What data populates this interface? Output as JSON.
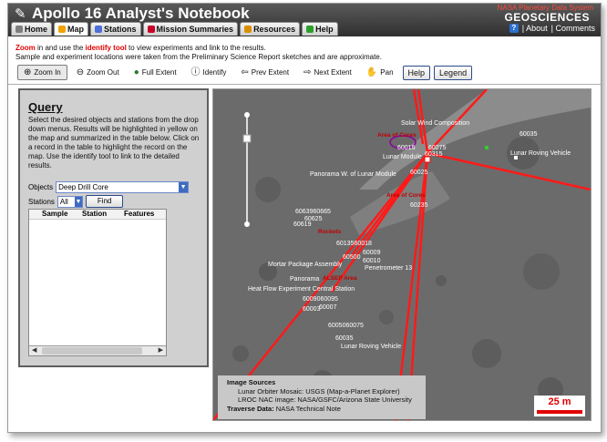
{
  "app": {
    "title": "Apollo 16 Analyst's Notebook",
    "nasa_line": "NASA Planetary Data System",
    "org_name": "GEOSCIENCES",
    "help_glyph": "?",
    "about_link": "| About",
    "comments_link": "| Comments"
  },
  "tabs": [
    {
      "label": "Home",
      "icon": "home-icon",
      "color": "#7e7e7e"
    },
    {
      "label": "Map",
      "icon": "map-icon",
      "color": "#f2a300"
    },
    {
      "label": "Stations",
      "icon": "stations-icon",
      "color": "#4f6fd8"
    },
    {
      "label": "Mission Summaries",
      "icon": "mission-icon",
      "color": "#c8002a"
    },
    {
      "label": "Resources",
      "icon": "resources-icon",
      "color": "#d89000"
    },
    {
      "label": "Help",
      "icon": "help-icon",
      "color": "#2aa02a"
    }
  ],
  "info": {
    "zoom_word": "Zoom",
    "line1_mid": " in and use the ",
    "identify_word": "identify tool",
    "line1_end": " to view experiments and link to the results.",
    "line2": "Sample and experiment locations were taken from the Preliminary Science Report sketches and are approximate."
  },
  "toolbar": {
    "zoom_in": "Zoom In",
    "zoom_out": "Zoom Out",
    "full_extent": "Full Extent",
    "identify": "Identify",
    "prev_extent": "Prev Extent",
    "next_extent": "Next Extent",
    "pan": "Pan",
    "help": "Help",
    "legend": "Legend"
  },
  "query": {
    "title": "Query",
    "description": "Select the desired objects and stations from the drop down menus. Results will be highlighted in yellow on the map and summarized in the table below. Click on a record in the table to highlight the record on the map. Use the identify tool to link to the detailed results.",
    "objects_label": "Objects",
    "objects_value": "Deep Drill Core",
    "stations_label": "Stations",
    "stations_value": "All",
    "find_label": "Find",
    "table_headers": [
      "Sample",
      "Station",
      "Features"
    ]
  },
  "map": {
    "labels": [
      {
        "text": "Solar Wind Composition"
      },
      {
        "text": "Area of Cores"
      },
      {
        "text": "60015"
      },
      {
        "text": "60275"
      },
      {
        "text": "Lunar Module"
      },
      {
        "text": "60315"
      },
      {
        "text": "60035"
      },
      {
        "text": "Lunar Roving Vehicle"
      },
      {
        "text": "Panorama W. of Lunar Module"
      },
      {
        "text": "60025"
      },
      {
        "text": "Area of Cores"
      },
      {
        "text": "60235"
      },
      {
        "text": "6063960665"
      },
      {
        "text": "60625"
      },
      {
        "text": "60619"
      },
      {
        "text": "Rockets"
      },
      {
        "text": "6013560018"
      },
      {
        "text": "60009"
      },
      {
        "text": "60500"
      },
      {
        "text": "60010"
      },
      {
        "text": "Mortar Package Assembly"
      },
      {
        "text": "Penetrometer 13"
      },
      {
        "text": "Panorama"
      },
      {
        "text": "ALSEP Area"
      },
      {
        "text": "Heat Flow Experiment Central Station"
      },
      {
        "text": "6009060095"
      },
      {
        "text": "60007"
      },
      {
        "text": "60003"
      },
      {
        "text": "6005060075"
      },
      {
        "text": "60035"
      },
      {
        "text": "Lunar Roving Vehicle"
      }
    ]
  },
  "sources": {
    "heading": "Image Sources",
    "line1": "Lunar Orbiter Mosaic: USGS (Map-a-Planet Explorer)",
    "line2": "LROC NAC image: NASA/GSFC/Arizona State University",
    "traverse_label": "Traverse Data:",
    "traverse_value": " NASA Technical Note"
  },
  "scale": {
    "label": "25 m"
  },
  "colors": {
    "accent_red": "#e00000",
    "traverse_red": "#ff1a1a",
    "label_red": "#c00000"
  }
}
